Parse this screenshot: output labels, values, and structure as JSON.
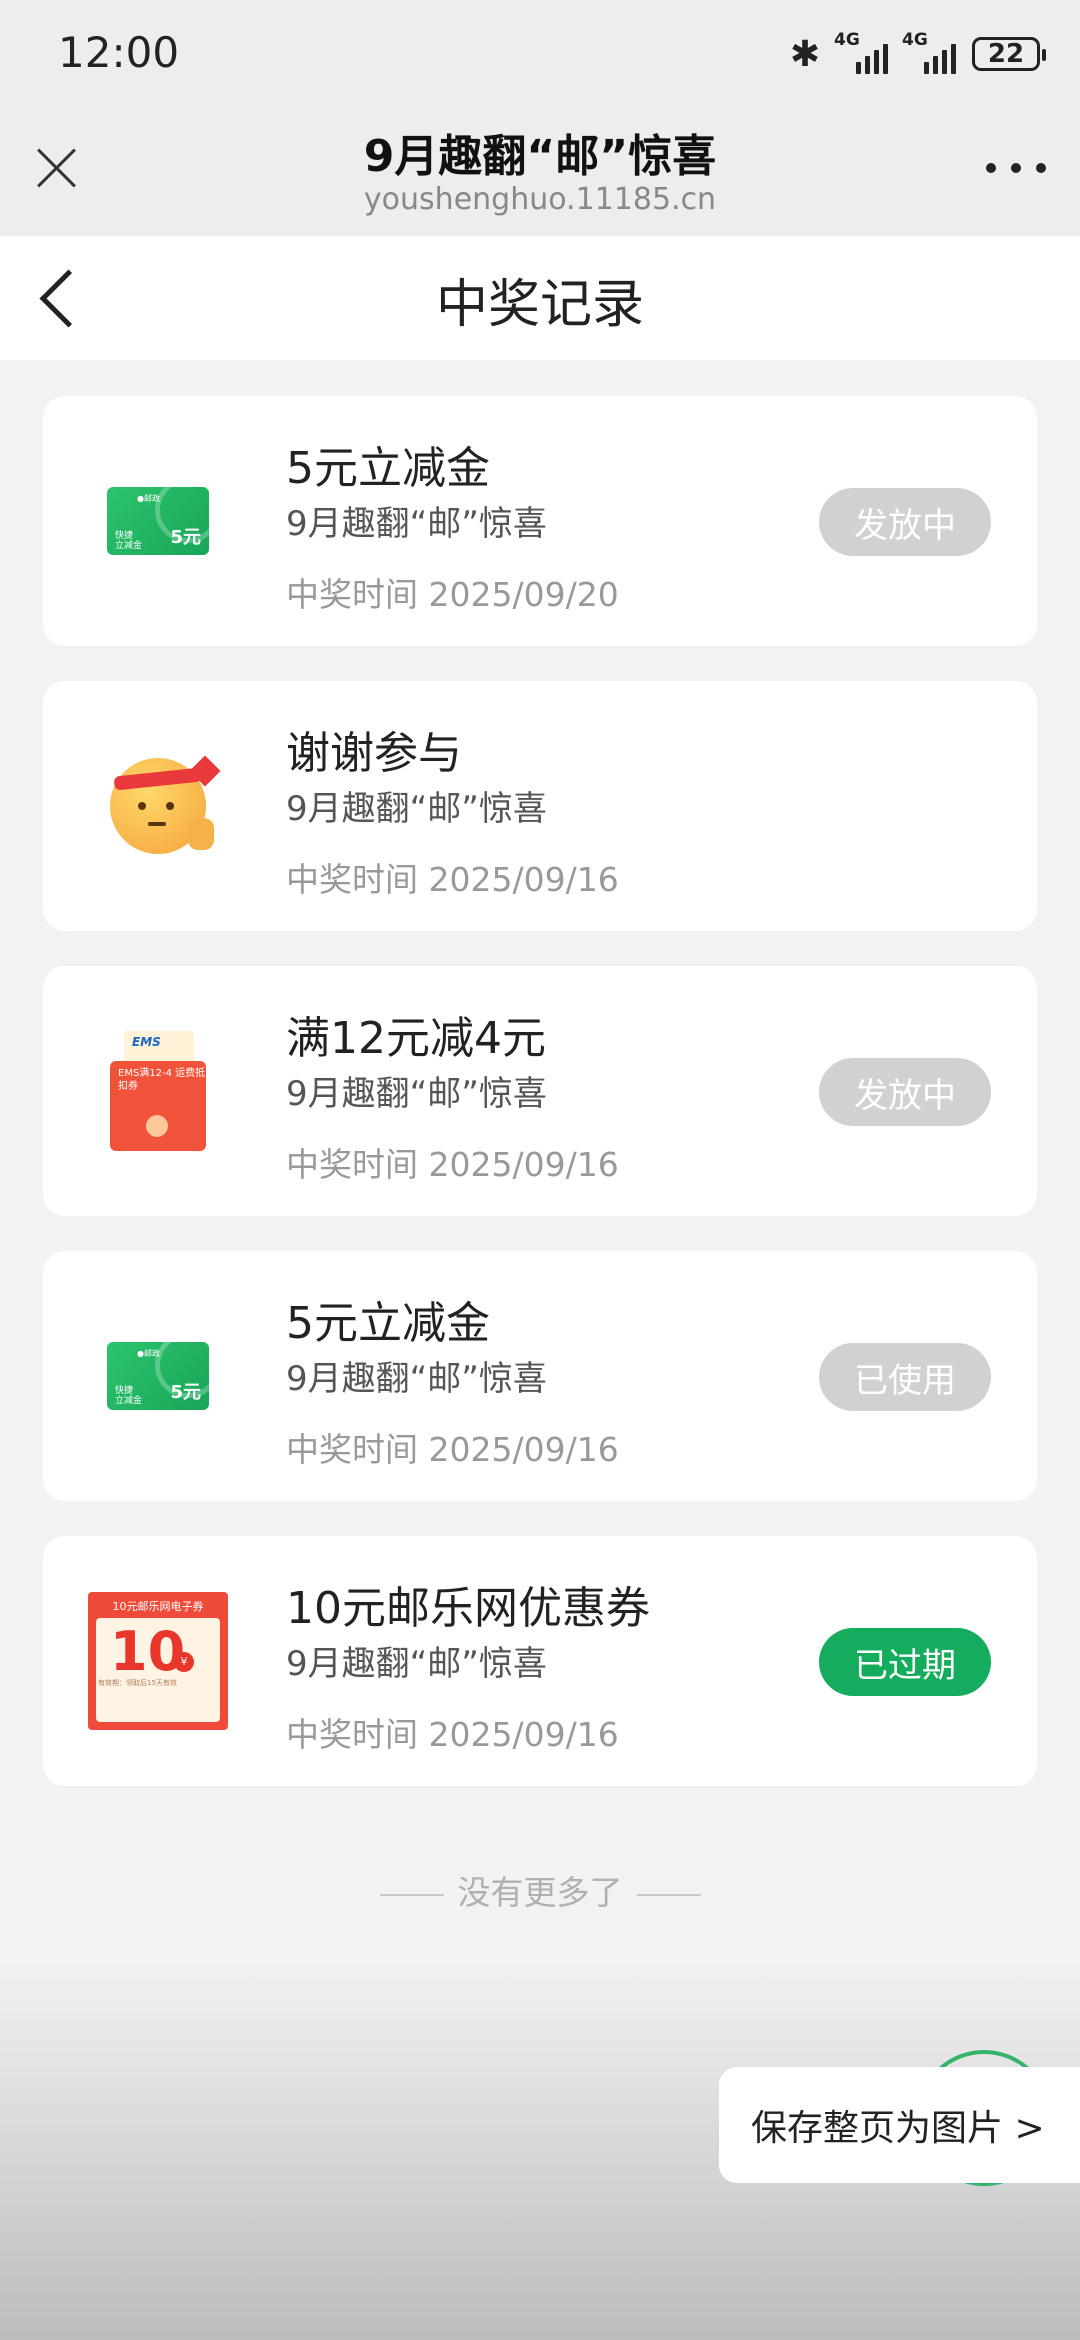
{
  "status_bar": {
    "time": "12:00",
    "network1": "4G",
    "network2": "4G",
    "battery": "22"
  },
  "browser": {
    "title": "9月趣翻“邮”惊喜",
    "url": "youshenghuo.11185.cn"
  },
  "page": {
    "title": "中奖记录"
  },
  "records": [
    {
      "title": "5元立减金",
      "subtitle": "9月趣翻“邮”惊喜",
      "time": "中奖时间 2025/09/20",
      "status": "发放中",
      "thumb": "green-card-icon",
      "thumb_amount": "5元"
    },
    {
      "title": "谢谢参与",
      "subtitle": "9月趣翻“邮”惊喜",
      "time": "中奖时间 2025/09/16",
      "status": "",
      "thumb": "emoji-salute-icon"
    },
    {
      "title": "满12元减4元",
      "subtitle": "9月趣翻“邮”惊喜",
      "time": "中奖时间 2025/09/16",
      "status": "发放中",
      "thumb": "ems-envelope-icon",
      "thumb_text": "EMS满12-4 运费抵扣券",
      "thumb_brand": "EMS"
    },
    {
      "title": "5元立减金",
      "subtitle": "9月趣翻“邮”惊喜",
      "time": "中奖时间 2025/09/16",
      "status": "已使用",
      "thumb": "green-card-icon",
      "thumb_amount": "5元"
    },
    {
      "title": "10元邮乐网优惠券",
      "subtitle": "9月趣翻“邮”惊喜",
      "time": "中奖时间 2025/09/16",
      "status": "已过期",
      "thumb": "red-coupon-icon",
      "thumb_top": "10元邮乐网电子券",
      "thumb_big": "10"
    }
  ],
  "footer": {
    "no_more": "没有更多了"
  },
  "save_button": {
    "label": "保存整页为图片 >"
  },
  "colors": {
    "accent_green": "#15ad5d",
    "badge_gray": "#d1d1d1",
    "background": "#f2f2f2"
  }
}
